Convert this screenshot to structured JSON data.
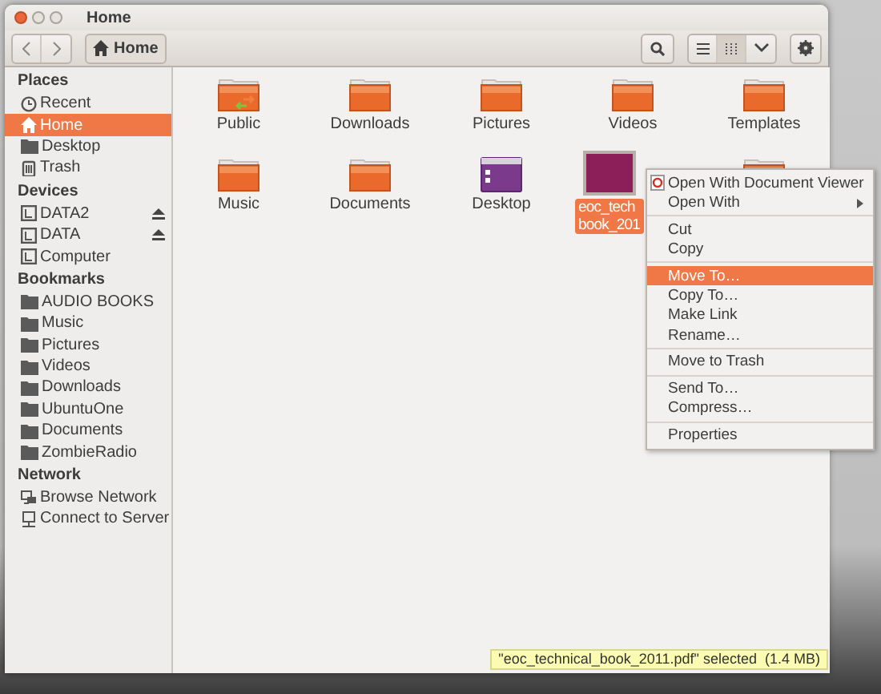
{
  "window": {
    "title": "Home"
  },
  "toolbar": {
    "path": "Home",
    "views": [
      {
        "kind": "list",
        "selected": false
      },
      {
        "kind": "grid",
        "selected": true
      },
      {
        "kind": "dropdown",
        "selected": false
      }
    ]
  },
  "sidebar": [
    {
      "heading": "Places",
      "items": [
        {
          "label": "Recent",
          "kind": "recent",
          "selected": false,
          "eject": false
        },
        {
          "label": "Home",
          "kind": "home",
          "selected": true,
          "eject": false
        },
        {
          "label": "Desktop",
          "kind": "folder",
          "selected": false,
          "eject": false
        },
        {
          "label": "Trash",
          "kind": "trash",
          "selected": false,
          "eject": false
        }
      ]
    },
    {
      "heading": "Devices",
      "items": [
        {
          "label": "DATA2",
          "kind": "drive",
          "selected": false,
          "eject": true
        },
        {
          "label": "DATA",
          "kind": "drive",
          "selected": false,
          "eject": true
        },
        {
          "label": "Computer",
          "kind": "drive",
          "selected": false,
          "eject": false
        }
      ]
    },
    {
      "heading": "Bookmarks",
      "items": [
        {
          "label": "AUDIO BOOKS",
          "kind": "folder",
          "selected": false,
          "eject": false
        },
        {
          "label": "Music",
          "kind": "folder",
          "selected": false,
          "eject": false
        },
        {
          "label": "Pictures",
          "kind": "folder",
          "selected": false,
          "eject": false
        },
        {
          "label": "Videos",
          "kind": "folder",
          "selected": false,
          "eject": false
        },
        {
          "label": "Downloads",
          "kind": "folder",
          "selected": false,
          "eject": false
        },
        {
          "label": "UbuntuOne",
          "kind": "folder",
          "selected": false,
          "eject": false
        },
        {
          "label": "Documents",
          "kind": "folder",
          "selected": false,
          "eject": false
        },
        {
          "label": "ZombieRadio",
          "kind": "folder",
          "selected": false,
          "eject": false
        }
      ]
    },
    {
      "heading": "Network",
      "items": [
        {
          "label": "Browse Network",
          "kind": "network",
          "selected": false,
          "eject": false
        },
        {
          "label": "Connect to Server",
          "kind": "server",
          "selected": false,
          "eject": false
        }
      ]
    }
  ],
  "files": [
    {
      "name": "Public",
      "kind": "public",
      "selected": false
    },
    {
      "name": "Downloads",
      "kind": "folder",
      "selected": false
    },
    {
      "name": "Pictures",
      "kind": "folder",
      "selected": false
    },
    {
      "name": "Videos",
      "kind": "folder",
      "selected": false
    },
    {
      "name": "Templates",
      "kind": "folder",
      "selected": false
    },
    {
      "name": "Music",
      "kind": "folder",
      "selected": false
    },
    {
      "name": "Documents",
      "kind": "folder",
      "selected": false
    },
    {
      "name": "Desktop",
      "kind": "desktop",
      "selected": false
    },
    {
      "name": "eoc_tech book_201",
      "kind": "pdf",
      "selected": true
    },
    {
      "kind": "folder",
      "selected": false
    }
  ],
  "context_menu": [
    {
      "kind": "item",
      "label": "Open With Document Viewer",
      "icon": true,
      "submenu": false,
      "selected": false
    },
    {
      "kind": "item",
      "label": "Open With",
      "icon": false,
      "submenu": true,
      "selected": false
    },
    {
      "kind": "separator"
    },
    {
      "kind": "item",
      "label": "Cut",
      "icon": false,
      "submenu": false,
      "selected": false
    },
    {
      "kind": "item",
      "label": "Copy",
      "icon": false,
      "submenu": false,
      "selected": false
    },
    {
      "kind": "separator"
    },
    {
      "kind": "item",
      "label": "Move To…",
      "icon": false,
      "submenu": false,
      "selected": true
    },
    {
      "kind": "item",
      "label": "Copy To…",
      "icon": false,
      "submenu": false,
      "selected": false
    },
    {
      "kind": "item",
      "label": "Make Link",
      "icon": false,
      "submenu": false,
      "selected": false
    },
    {
      "kind": "item",
      "label": "Rename…",
      "icon": false,
      "submenu": false,
      "selected": false
    },
    {
      "kind": "separator"
    },
    {
      "kind": "item",
      "label": "Move to Trash",
      "icon": false,
      "submenu": false,
      "selected": false
    },
    {
      "kind": "separator"
    },
    {
      "kind": "item",
      "label": "Send To…",
      "icon": false,
      "submenu": false,
      "selected": false
    },
    {
      "kind": "item",
      "label": "Compress…",
      "icon": false,
      "submenu": false,
      "selected": false
    },
    {
      "kind": "separator"
    },
    {
      "kind": "item",
      "label": "Properties",
      "icon": false,
      "submenu": false,
      "selected": false
    }
  ],
  "status": "\"eoc_technical_book_2011.pdf\" selected  (1.4 MB)"
}
